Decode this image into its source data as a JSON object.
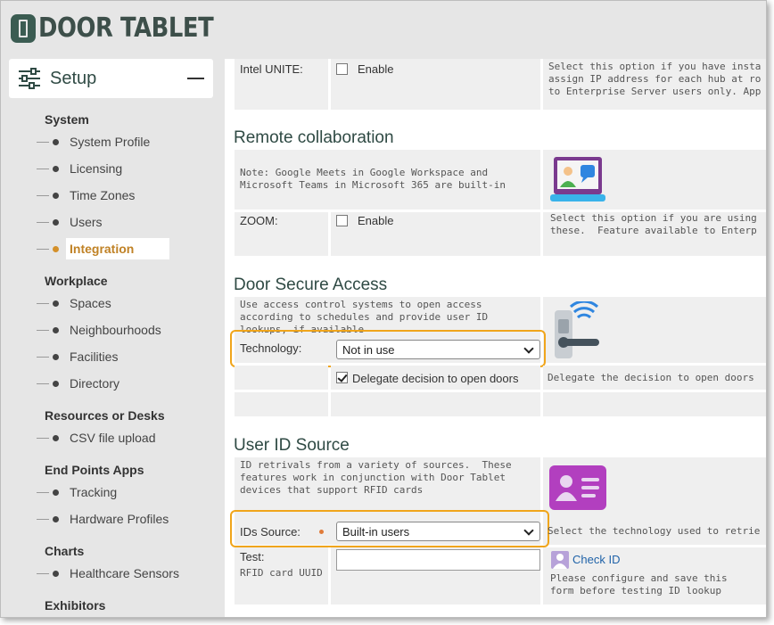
{
  "brand": {
    "name": "DOOR TABLET"
  },
  "sidebar": {
    "setup_label": "Setup",
    "groups": [
      {
        "label": "System",
        "items": [
          "System Profile",
          "Licensing",
          "Time Zones",
          "Users",
          "Integration"
        ]
      },
      {
        "label": "Workplace",
        "items": [
          "Spaces",
          "Neighbourhoods",
          "Facilities",
          "Directory"
        ]
      },
      {
        "label": "Resources or Desks",
        "items": [
          "CSV file upload"
        ]
      },
      {
        "label": "End Points Apps",
        "items": [
          "Tracking",
          "Hardware Profiles"
        ]
      },
      {
        "label": "Charts",
        "items": [
          "Healthcare Sensors"
        ]
      },
      {
        "label": "Exhibitors",
        "items": []
      }
    ],
    "active_item": "Integration",
    "accent_color": "#d4902a"
  },
  "main": {
    "intel": {
      "label": "Intel UNITE:",
      "checkbox_label": "Enable",
      "checked": false,
      "desc": "Select this option if you have insta\nassign IP address for each hub at ro\nto Enterprise Server users only. App"
    },
    "remote": {
      "title": "Remote collaboration",
      "note": "Note: Google Meets in Google Workspace and\nMicrosoft Teams in Microsoft 365 are built-in",
      "zoom_label": "ZOOM:",
      "zoom_checkbox_label": "Enable",
      "zoom_checked": false,
      "zoom_desc": "Select this option if you are using\nthese.  Feature available to Enterp"
    },
    "door_access": {
      "title": "Door Secure Access",
      "desc": "Use access control systems to open access\naccording to schedules and provide user ID\nlookups, if available",
      "technology_label": "Technology:",
      "technology_value": "Not in use",
      "delegate_label": "Delegate decision to open doors",
      "delegate_checked": true,
      "delegate_desc": "Delegate the decision to open doors"
    },
    "user_id": {
      "title": "User ID Source",
      "desc": "ID retrivals from a variety of sources.  These\nfeatures work in conjunction with Door Tablet\ndevices that support RFID cards",
      "source_label": "IDs Source:",
      "source_value": "Built-in users",
      "source_desc": "Select the technology used to retrie",
      "test_label": "Test:",
      "test_sublabel": "RFID card UUID",
      "test_value": "",
      "check_id_label": "Check ID",
      "check_note": "Please configure and save this\nform before testing ID lookup"
    },
    "highlight_color": "#f0a51b"
  }
}
